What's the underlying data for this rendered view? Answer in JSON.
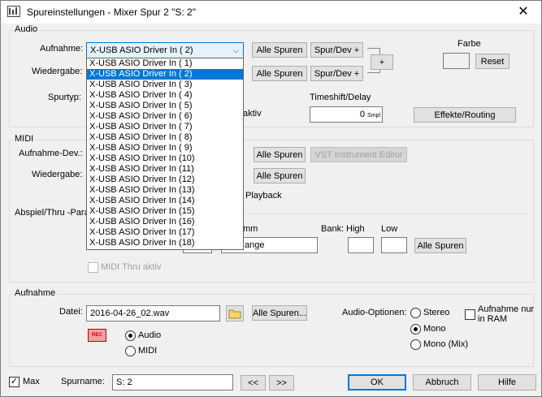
{
  "window": {
    "title": "Spureinstellungen - Mixer Spur 2 \"S:  2\"",
    "close": "✕"
  },
  "audio": {
    "group": "Audio",
    "aufnahme_label": "Aufnahme:",
    "aufnahme_value": "X-USB ASIO Driver In ( 2)",
    "wiedergabe_label": "Wiedergabe:",
    "spurtyp_label": "Spurtyp:",
    "alle_spuren_1": "Alle Spuren",
    "alle_spuren_2": "Alle Spuren",
    "spurdev_1": "Spur/Dev +",
    "spurdev_2": "Spur/Dev +",
    "plus": "+",
    "farbe": "Farbe",
    "reset": "Reset",
    "aktiv_partial": "aktiv",
    "timeshift_label": "Timeshift/Delay",
    "timeshift_value": "0",
    "timeshift_unit": "Smpl",
    "effekte": "Effekte/Routing"
  },
  "dropdown_items": [
    "X-USB ASIO Driver In ( 1)",
    "X-USB ASIO Driver In ( 2)",
    "X-USB ASIO Driver In ( 3)",
    "X-USB ASIO Driver In ( 4)",
    "X-USB ASIO Driver In ( 5)",
    "X-USB ASIO Driver In ( 6)",
    "X-USB ASIO Driver In ( 7)",
    "X-USB ASIO Driver In ( 8)",
    "X-USB ASIO Driver In ( 9)",
    "X-USB ASIO Driver In (10)",
    "X-USB ASIO Driver In (11)",
    "X-USB ASIO Driver In (12)",
    "X-USB ASIO Driver In (13)",
    "X-USB ASIO Driver In (14)",
    "X-USB ASIO Driver In (15)",
    "X-USB ASIO Driver In (16)",
    "X-USB ASIO Driver In (17)",
    "X-USB ASIO Driver In (18)"
  ],
  "midi": {
    "group": "MIDI",
    "aufnahme_dev_label": "Aufnahme-Dev.:",
    "wiedergabe_label": "Wiedergabe:",
    "alle_spuren_1": "Alle Spuren",
    "alle_spuren_2": "Alle Spuren",
    "vst_editor": "VST Instrument Editor",
    "playback_partial": "Playback",
    "abspiel_label": "Abspiel/Thru -Para",
    "programm_partial": "mm",
    "bank_label": "Bank:",
    "high_label": "High",
    "low_label": "Low",
    "alle_spuren_3": "Alle Spuren",
    "range_partial": "ange",
    "midi_thru": "MIDI Thru aktiv"
  },
  "aufnahme": {
    "group": "Aufnahme",
    "datei_label": "Datei:",
    "datei_value": "2016-04-26_02.wav",
    "alle_spuren": "Alle Spuren...",
    "rec": "REC",
    "audio_radio": "Audio",
    "midi_radio": "MIDI",
    "audio_optionen_label": "Audio-Optionen:",
    "stereo": "Stereo",
    "mono": "Mono",
    "mono_mix": "Mono (Mix)",
    "ram_label_1": "Aufnahme nur",
    "ram_label_2": "in RAM"
  },
  "footer": {
    "max_label": "Max",
    "spurname_label": "Spurname:",
    "spurname_value": "S:  2",
    "prev": "<<",
    "next": ">>",
    "ok": "OK",
    "abbruch": "Abbruch",
    "hilfe": "Hilfe"
  }
}
